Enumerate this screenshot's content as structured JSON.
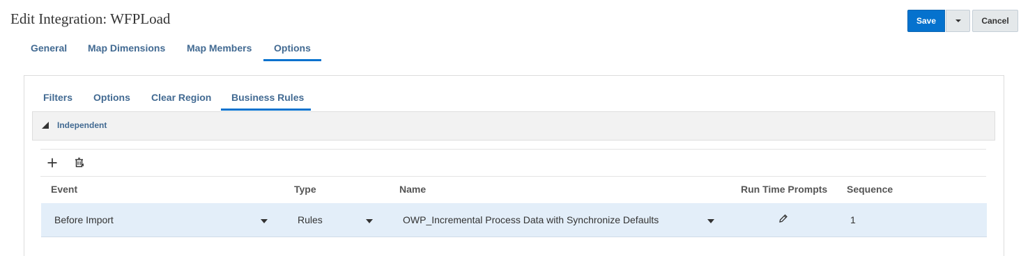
{
  "page": {
    "title": "Edit Integration: WFPLoad"
  },
  "actions": {
    "save_label": "Save",
    "cancel_label": "Cancel"
  },
  "main_tabs": [
    {
      "label": "General"
    },
    {
      "label": "Map Dimensions"
    },
    {
      "label": "Map Members"
    },
    {
      "label": "Options",
      "selected": true
    }
  ],
  "sub_tabs": [
    {
      "label": "Filters"
    },
    {
      "label": "Options"
    },
    {
      "label": "Clear Region"
    },
    {
      "label": "Business Rules",
      "selected": true
    }
  ],
  "section": {
    "label": "Independent",
    "expanded": true
  },
  "toolbar": {
    "icons": [
      "plus-icon",
      "delete-icon"
    ]
  },
  "table": {
    "columns": [
      "Event",
      "Type",
      "Name",
      "Run Time Prompts",
      "Sequence"
    ],
    "rows": [
      {
        "event": "Before Import",
        "type": "Rules",
        "name": "OWP_Incremental Process Data with Synchronize Defaults",
        "run_time_prompts_icon": "pencil-icon",
        "sequence": "1"
      }
    ]
  },
  "colors": {
    "accent": "#0572ce",
    "tab_text": "#426a92",
    "row_selected": "#e3eef9"
  }
}
